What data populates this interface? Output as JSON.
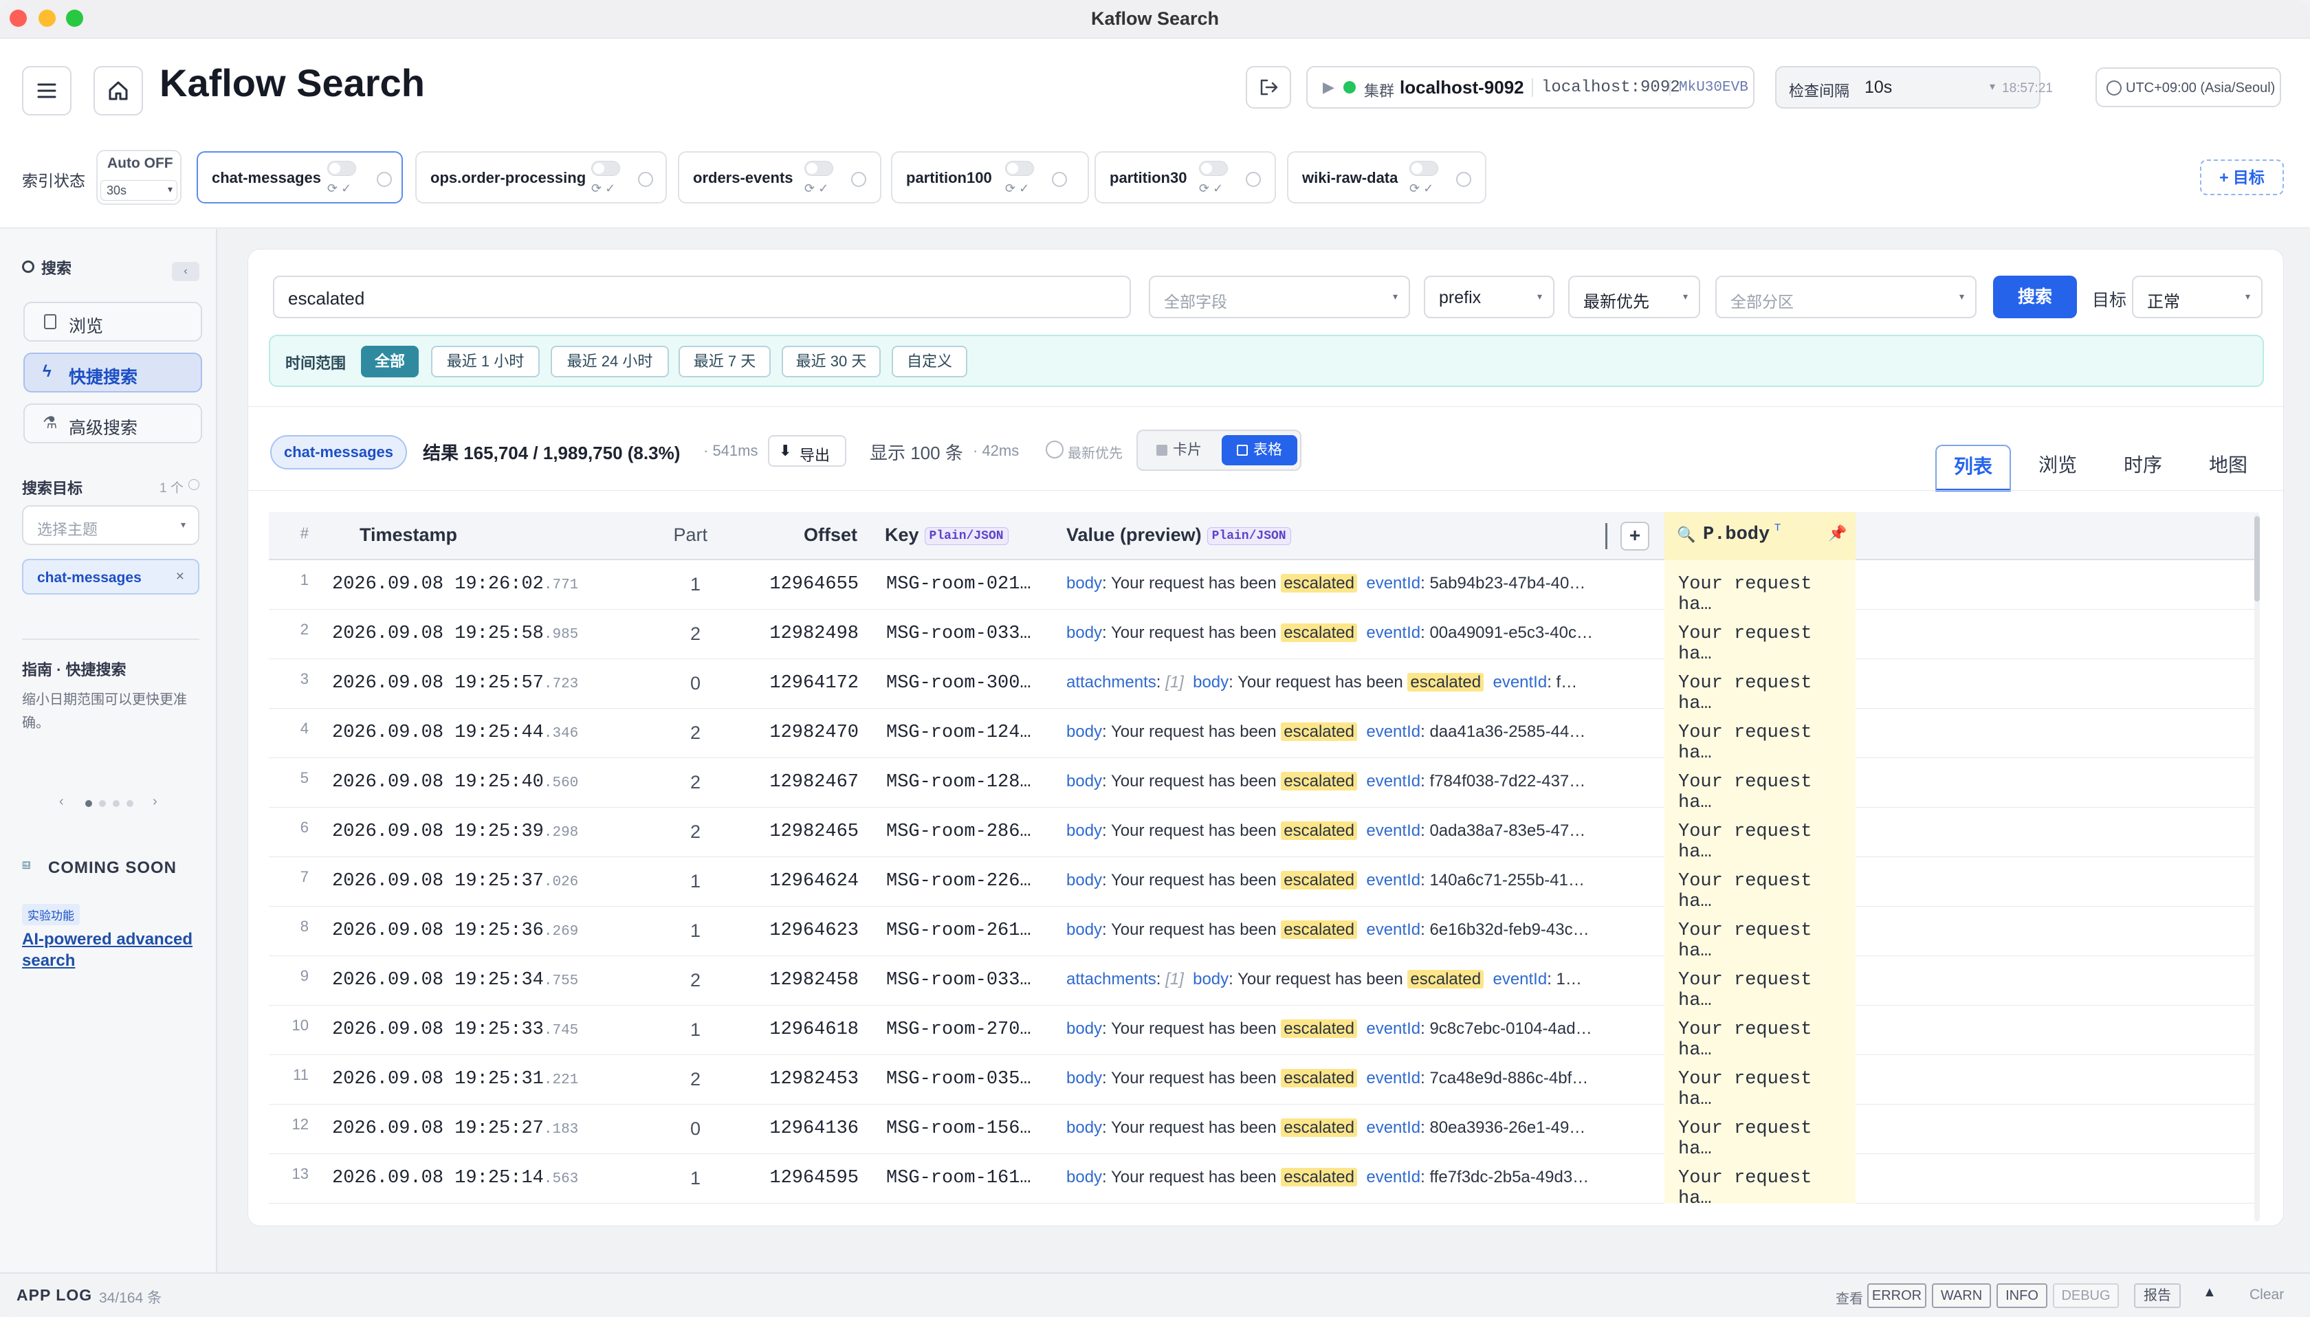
{
  "window": {
    "title": "Kaflow Search"
  },
  "header": {
    "app_title": "Kaflow Search",
    "cluster_label": "集群",
    "cluster_name": "localhost-9092",
    "cluster_host": "localhost:9092",
    "cluster_id": "MkU30EVB",
    "interval_label": "检查间隔",
    "interval_value": "10s",
    "clock": "18:57:21",
    "timezone": "UTC+09:00 (Asia/Seoul)"
  },
  "index_bar": {
    "label": "索引状态",
    "auto_label": "Auto OFF",
    "auto_interval": "30s",
    "add_target": "+ 目标",
    "chips": [
      "chat-messages",
      "ops.order-processing",
      "orders-events",
      "partition100",
      "partition30",
      "wiki-raw-data"
    ]
  },
  "sidebar": {
    "search_title": "搜索",
    "nav": [
      "浏览",
      "快捷搜索",
      "高级搜索"
    ],
    "target_title": "搜索目标",
    "target_count": "1 个",
    "topic_placeholder": "选择主题",
    "selected_topic": "chat-messages",
    "guide_title": "指南 · 快捷搜索",
    "guide_text": "缩小日期范围可以更快更准确。",
    "coming_soon": "COMING SOON",
    "soon_badge": "SOON",
    "experimental": "实验功能",
    "ai_link": "AI-powered advanced search"
  },
  "search": {
    "query": "escalated",
    "field_placeholder": "全部字段",
    "mode": "prefix",
    "sort": "最新优先",
    "partition_placeholder": "全部分区",
    "search_button": "搜索",
    "target_label": "目标",
    "target_value": "正常"
  },
  "time_range": {
    "label": "时间范围",
    "options": [
      "全部",
      "最近 1 小时",
      "最近 24 小时",
      "最近 7 天",
      "最近 30 天",
      "自定义"
    ]
  },
  "results": {
    "topic": "chat-messages",
    "summary": "结果 165,704 / 1,989,750 (8.3%)",
    "time": "· 541ms",
    "export": "导出",
    "shown": "显示 100 条",
    "shown_time": "· 42ms",
    "order_hint": "最新优先",
    "view_card": "卡片",
    "view_table": "表格"
  },
  "tabs": [
    "列表",
    "浏览",
    "时序",
    "地图"
  ],
  "table": {
    "headers": {
      "num": "#",
      "timestamp": "Timestamp",
      "part": "Part",
      "offset": "Offset",
      "key": "Key",
      "value": "Value (preview)",
      "fmt": "Plain/JSON",
      "pinned": "P.body",
      "pinned_sup": "T",
      "add": "+"
    },
    "rows": [
      {
        "n": "1",
        "ts": "2026.09.08 19:26:02",
        "ms": ".771",
        "part": "1",
        "offset": "12964655",
        "key": "MSG-room-021…",
        "pre": "",
        "msg": "Your request has been",
        "hl": "escalated",
        "k2": "eventId",
        "v2": "5ab94b23-47b4-40…",
        "pin": "Your request ha…"
      },
      {
        "n": "2",
        "ts": "2026.09.08 19:25:58",
        "ms": ".985",
        "part": "2",
        "offset": "12982498",
        "key": "MSG-room-033…",
        "pre": "",
        "msg": "Your request has been",
        "hl": "escalated",
        "k2": "eventId",
        "v2": "00a49091-e5c3-40c…",
        "pin": "Your request ha…"
      },
      {
        "n": "3",
        "ts": "2026.09.08 19:25:57",
        "ms": ".723",
        "part": "0",
        "offset": "12964172",
        "key": "MSG-room-300…",
        "pre": "attachments",
        "pre_v": "[1]",
        "msg": "Your request has been",
        "hl": "escalated",
        "k2": "eventId",
        "v2": "f…",
        "pin": "Your request ha…"
      },
      {
        "n": "4",
        "ts": "2026.09.08 19:25:44",
        "ms": ".346",
        "part": "2",
        "offset": "12982470",
        "key": "MSG-room-124…",
        "pre": "",
        "msg": "Your request has been",
        "hl": "escalated",
        "k2": "eventId",
        "v2": "daa41a36-2585-44…",
        "pin": "Your request ha…"
      },
      {
        "n": "5",
        "ts": "2026.09.08 19:25:40",
        "ms": ".560",
        "part": "2",
        "offset": "12982467",
        "key": "MSG-room-128…",
        "pre": "",
        "msg": "Your request has been",
        "hl": "escalated",
        "k2": "eventId",
        "v2": "f784f038-7d22-437…",
        "pin": "Your request ha…"
      },
      {
        "n": "6",
        "ts": "2026.09.08 19:25:39",
        "ms": ".298",
        "part": "2",
        "offset": "12982465",
        "key": "MSG-room-286…",
        "pre": "",
        "msg": "Your request has been",
        "hl": "escalated",
        "k2": "eventId",
        "v2": "0ada38a7-83e5-47…",
        "pin": "Your request ha…"
      },
      {
        "n": "7",
        "ts": "2026.09.08 19:25:37",
        "ms": ".026",
        "part": "1",
        "offset": "12964624",
        "key": "MSG-room-226…",
        "pre": "",
        "msg": "Your request has been",
        "hl": "escalated",
        "k2": "eventId",
        "v2": "140a6c71-255b-41…",
        "pin": "Your request ha…"
      },
      {
        "n": "8",
        "ts": "2026.09.08 19:25:36",
        "ms": ".269",
        "part": "1",
        "offset": "12964623",
        "key": "MSG-room-261…",
        "pre": "",
        "msg": "Your request has been",
        "hl": "escalated",
        "k2": "eventId",
        "v2": "6e16b32d-feb9-43c…",
        "pin": "Your request ha…"
      },
      {
        "n": "9",
        "ts": "2026.09.08 19:25:34",
        "ms": ".755",
        "part": "2",
        "offset": "12982458",
        "key": "MSG-room-033…",
        "pre": "attachments",
        "pre_v": "[1]",
        "msg": "Your request has been",
        "hl": "escalated",
        "k2": "eventId",
        "v2": "1…",
        "pin": "Your request ha…"
      },
      {
        "n": "10",
        "ts": "2026.09.08 19:25:33",
        "ms": ".745",
        "part": "1",
        "offset": "12964618",
        "key": "MSG-room-270…",
        "pre": "",
        "msg": "Your request has been",
        "hl": "escalated",
        "k2": "eventId",
        "v2": "9c8c7ebc-0104-4ad…",
        "pin": "Your request ha…"
      },
      {
        "n": "11",
        "ts": "2026.09.08 19:25:31",
        "ms": ".221",
        "part": "2",
        "offset": "12982453",
        "key": "MSG-room-035…",
        "pre": "",
        "msg": "Your request has been",
        "hl": "escalated",
        "k2": "eventId",
        "v2": "7ca48e9d-886c-4bf…",
        "pin": "Your request ha…"
      },
      {
        "n": "12",
        "ts": "2026.09.08 19:25:27",
        "ms": ".183",
        "part": "0",
        "offset": "12964136",
        "key": "MSG-room-156…",
        "pre": "",
        "msg": "Your request has been",
        "hl": "escalated",
        "k2": "eventId",
        "v2": "80ea3936-26e1-49…",
        "pin": "Your request ha…"
      },
      {
        "n": "13",
        "ts": "2026.09.08 19:25:14",
        "ms": ".563",
        "part": "1",
        "offset": "12964595",
        "key": "MSG-room-161…",
        "pre": "",
        "msg": "Your request has been",
        "hl": "escalated",
        "k2": "eventId",
        "v2": "ffe7f3dc-2b5a-49d3…",
        "pin": "Your request ha…"
      }
    ]
  },
  "footer": {
    "app_log": "APP LOG",
    "log_count": "34/164 条",
    "view_label": "查看",
    "levels": [
      "ERROR",
      "WARN",
      "INFO",
      "DEBUG"
    ],
    "report": "报告",
    "clear": "Clear"
  },
  "colors": {
    "accent": "#2563eb",
    "active_nav": "#dbe4f7",
    "highlight": "#fde68a",
    "pinned_col": "#fffbe0",
    "time_range_bg": "#eafaf8"
  }
}
